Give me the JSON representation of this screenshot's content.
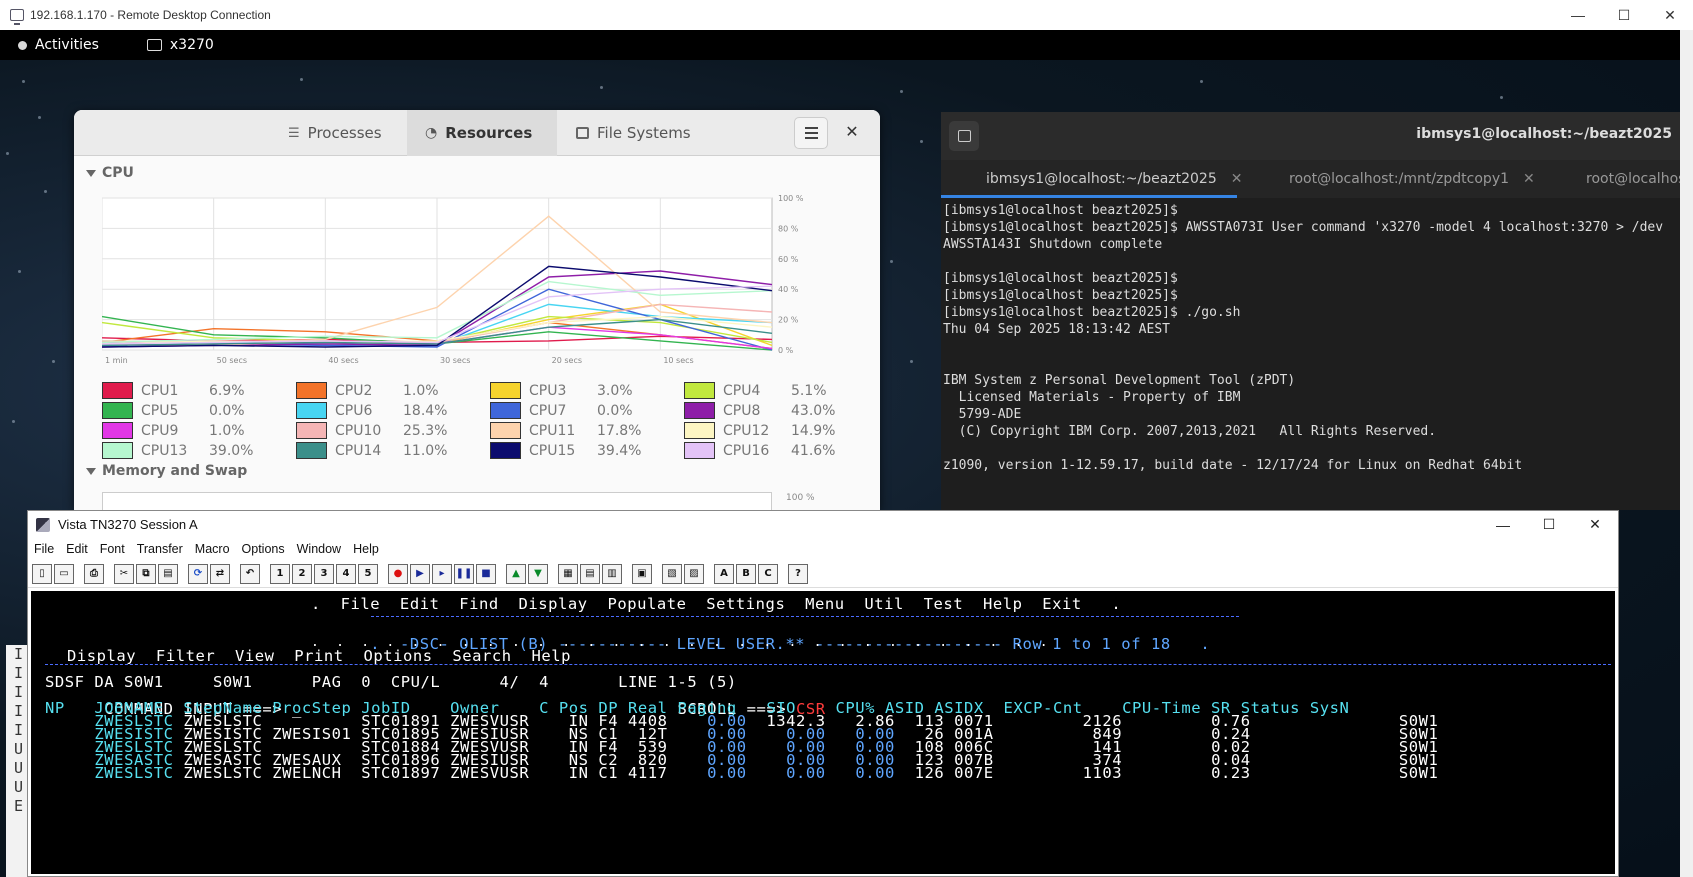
{
  "rdp": {
    "title": "192.168.1.170 - Remote Desktop Connection",
    "minimize": "—",
    "maximize": "☐",
    "close": "✕"
  },
  "gnome": {
    "activities": "Activities",
    "app_name": "x3270"
  },
  "sysmon": {
    "tabs": [
      "Processes",
      "Resources",
      "File Systems"
    ],
    "active_tab": "Resources",
    "cpu_title": "CPU",
    "memory_title": "Memory and Swap",
    "axis_y": [
      "100 %",
      "80 %",
      "60 %",
      "40 %",
      "20 %",
      "0 %"
    ],
    "axis_x": [
      "1 min",
      "50 secs",
      "40 secs",
      "30 secs",
      "20 secs",
      "10 secs"
    ],
    "mem_axis_top": "100 %",
    "cpus": [
      {
        "name": "CPU1",
        "value": "6.9%",
        "color": "#e01b4c"
      },
      {
        "name": "CPU2",
        "value": "1.0%",
        "color": "#f37329"
      },
      {
        "name": "CPU3",
        "value": "3.0%",
        "color": "#f6d32d"
      },
      {
        "name": "CPU4",
        "value": "5.1%",
        "color": "#c1e83e"
      },
      {
        "name": "CPU5",
        "value": "0.0%",
        "color": "#33b450"
      },
      {
        "name": "CPU6",
        "value": "18.4%",
        "color": "#48d5f2"
      },
      {
        "name": "CPU7",
        "value": "0.0%",
        "color": "#3f66d9"
      },
      {
        "name": "CPU8",
        "value": "43.0%",
        "color": "#8e1ea8"
      },
      {
        "name": "CPU9",
        "value": "1.0%",
        "color": "#e237e6"
      },
      {
        "name": "CPU10",
        "value": "25.3%",
        "color": "#f5b5b5"
      },
      {
        "name": "CPU11",
        "value": "17.8%",
        "color": "#fdd3ad"
      },
      {
        "name": "CPU12",
        "value": "14.9%",
        "color": "#fdf6c3"
      },
      {
        "name": "CPU13",
        "value": "39.0%",
        "color": "#b6f7cf"
      },
      {
        "name": "CPU14",
        "value": "11.0%",
        "color": "#3b8f8a"
      },
      {
        "name": "CPU15",
        "value": "39.4%",
        "color": "#0b0b6e"
      },
      {
        "name": "CPU16",
        "value": "41.6%",
        "color": "#e3c3f7"
      }
    ]
  },
  "terminal": {
    "title": "ibmsys1@localhost:~/beazt2025",
    "tabs": [
      "ibmsys1@localhost:~/beazt2025",
      "root@localhost:/mnt/zpdtcopy1",
      "root@localhos"
    ],
    "lines": [
      "[ibmsys1@localhost beazt2025]$",
      "[ibmsys1@localhost beazt2025]$ AWSSTA073I User command 'x3270 -model 4 localhost:3270 > /dev",
      "AWSSTA143I Shutdown complete",
      "",
      "[ibmsys1@localhost beazt2025]$",
      "[ibmsys1@localhost beazt2025]$",
      "[ibmsys1@localhost beazt2025]$ ./go.sh",
      "Thu 04 Sep 2025 18:13:42 AEST",
      "",
      "",
      "IBM System z Personal Development Tool (zPDT)",
      "  Licensed Materials - Property of IBM",
      "  5799-ADE",
      "  (C) Copyright IBM Corp. 2007,2013,2021   All Rights Reserved.",
      "",
      "z1090, version 1-12.59.17, build date - 12/17/24 for Linux on Redhat 64bit"
    ]
  },
  "vista": {
    "title": "Vista TN3270 Session A",
    "menu": [
      "File",
      "Edit",
      "Font",
      "Transfer",
      "Macro",
      "Options",
      "Window",
      "Help"
    ],
    "toolbar": [
      "new",
      "open",
      "print",
      "cut",
      "copy",
      "paste",
      "refresh",
      "swap",
      "undo",
      "1",
      "2",
      "3",
      "4",
      "5",
      "rec",
      "play",
      "step",
      "pause",
      "stop",
      "up",
      "down",
      "t1",
      "t2",
      "t3",
      "t4",
      "t5",
      "t6",
      "A",
      "B",
      "C",
      "?"
    ],
    "screen": {
      "ispf_menu": ".  File  Edit  Find  Display  Populate  Settings  Menu  Util  Test  Help  Exit   .",
      "ispf_title_pre": ".  -DSC- OLIST (B) ----------- LEVEL USER.** ------------------- Row 1 to 1 of 18   .",
      "dots": ".  .  .  .  .  .  .  .  .  .  .  .  .  .  .  .  .  .  .  .  .  .  .  .  .  .  .  .  .  .",
      "sdsf_menu": "Display  Filter  View  Print  Options  Search  Help",
      "status_line": "SDSF DA S0W1     S0W1      PAG  0  CPU/L      4/  4       LINE 1-5 (5)",
      "command_line": "COMMAND INPUT ===> _                                      SCROLL ===>",
      "scroll_value": "CSR",
      "header": "NP   JOBNAME  StepName ProcStep JobID    Owner    C Pos DP Real Paging   SIO    CPU% ASID ASIDX  EXCP-Cnt    CPU-Time SR Status SysN",
      "rows": [
        {
          "jobname": "ZWESLSTC",
          "stepname": "ZWESLSTC",
          "procstep": "        ",
          "jobid": "STC01891",
          "owner": "ZWESVUSR",
          "c": " ",
          "pos": "IN",
          "dp": "F4",
          "real": "4408",
          "paging": "0.00",
          "sio": "1342.3",
          "cpu": "2.86",
          "asid": " 113",
          "asidx": "0071",
          "excp": "2126",
          "cputime": "0.76",
          "sysn": "S0W1"
        },
        {
          "jobname": "ZWESISTC",
          "stepname": "ZWESISTC",
          "procstep": "ZWESIS01",
          "jobid": "STC01895",
          "owner": "ZWESIUSR",
          "c": " ",
          "pos": "NS",
          "dp": "C1",
          "real": " 12T",
          "paging": "0.00",
          "sio": "  0.00",
          "cpu": "0.00",
          "asid": "  26",
          "asidx": "001A",
          "excp": " 849",
          "cputime": "0.24",
          "sysn": "S0W1"
        },
        {
          "jobname": "ZWESLSTC",
          "stepname": "ZWESLSTC",
          "procstep": "        ",
          "jobid": "STC01884",
          "owner": "ZWESVUSR",
          "c": " ",
          "pos": "IN",
          "dp": "F4",
          "real": " 539",
          "paging": "0.00",
          "sio": "  0.00",
          "cpu": "0.00",
          "asid": " 108",
          "asidx": "006C",
          "excp": " 141",
          "cputime": "0.02",
          "sysn": "S0W1"
        },
        {
          "jobname": "ZWESASTC",
          "stepname": "ZWESASTC",
          "procstep": "ZWESAUX ",
          "jobid": "STC01896",
          "owner": "ZWESIUSR",
          "c": " ",
          "pos": "NS",
          "dp": "C2",
          "real": " 820",
          "paging": "0.00",
          "sio": "  0.00",
          "cpu": "0.00",
          "asid": " 123",
          "asidx": "007B",
          "excp": " 374",
          "cputime": "0.04",
          "sysn": "S0W1"
        },
        {
          "jobname": "ZWESLSTC",
          "stepname": "ZWESLSTC",
          "procstep": "ZWELNCH ",
          "jobid": "STC01897",
          "owner": "ZWESVUSR",
          "c": " ",
          "pos": "IN",
          "dp": "C1",
          "real": "4117",
          "paging": "0.00",
          "sio": "  0.00",
          "cpu": "0.00",
          "asid": " 126",
          "asidx": "007E",
          "excp": "1103",
          "cputime": "0.23",
          "sysn": "S0W1"
        }
      ]
    }
  },
  "behind_window_letters": [
    "I",
    "I",
    "I",
    "I",
    "I",
    "U",
    "U",
    "U",
    "E"
  ],
  "chart_data": {
    "type": "line",
    "title": "CPU",
    "ylim": [
      0,
      100
    ],
    "x": [
      -60,
      -50,
      -40,
      -30,
      -20,
      -10,
      0
    ],
    "series": [
      {
        "name": "CPU1",
        "values": [
          8,
          6,
          7,
          5,
          6,
          9,
          7
        ]
      },
      {
        "name": "CPU2",
        "values": [
          5,
          14,
          12,
          6,
          18,
          10,
          1
        ]
      },
      {
        "name": "CPU3",
        "values": [
          4,
          3,
          5,
          4,
          20,
          30,
          3
        ]
      },
      {
        "name": "CPU4",
        "values": [
          18,
          8,
          6,
          5,
          22,
          18,
          5
        ]
      },
      {
        "name": "CPU5",
        "values": [
          22,
          10,
          8,
          4,
          12,
          6,
          0
        ]
      },
      {
        "name": "CPU6",
        "values": [
          6,
          5,
          4,
          3,
          30,
          22,
          18
        ]
      },
      {
        "name": "CPU7",
        "values": [
          3,
          4,
          3,
          2,
          40,
          20,
          0
        ]
      },
      {
        "name": "CPU8",
        "values": [
          2,
          3,
          4,
          3,
          48,
          52,
          43
        ]
      },
      {
        "name": "CPU9",
        "values": [
          5,
          6,
          5,
          4,
          15,
          10,
          1
        ]
      },
      {
        "name": "CPU10",
        "values": [
          4,
          3,
          6,
          5,
          18,
          30,
          25
        ]
      },
      {
        "name": "CPU11",
        "values": [
          6,
          5,
          7,
          28,
          88,
          25,
          18
        ]
      },
      {
        "name": "CPU12",
        "values": [
          4,
          6,
          5,
          6,
          18,
          22,
          15
        ]
      },
      {
        "name": "CPU13",
        "values": [
          5,
          7,
          9,
          8,
          45,
          36,
          39
        ]
      },
      {
        "name": "CPU14",
        "values": [
          3,
          4,
          5,
          4,
          15,
          20,
          11
        ]
      },
      {
        "name": "CPU15",
        "values": [
          2,
          3,
          2,
          3,
          55,
          48,
          39
        ]
      },
      {
        "name": "CPU16",
        "values": [
          4,
          5,
          6,
          5,
          35,
          40,
          42
        ]
      }
    ]
  }
}
